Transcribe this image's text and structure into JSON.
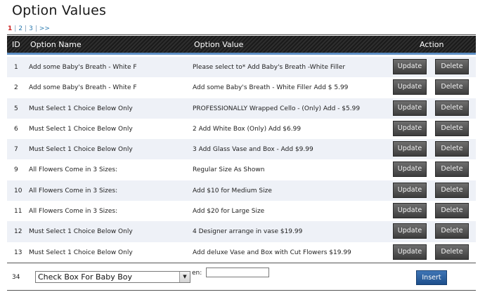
{
  "page": {
    "title": "Option Values"
  },
  "pagination": {
    "pages": [
      "1",
      "2",
      "3"
    ],
    "active": "1",
    "next": ">>"
  },
  "table": {
    "headers": {
      "id": "ID",
      "name": "Option Name",
      "value": "Option Value",
      "action": "Action"
    },
    "rows": [
      {
        "id": "1",
        "name": "Add some Baby's Breath - White F",
        "value": "Please select to* Add Baby's Breath -White Filler"
      },
      {
        "id": "2",
        "name": "Add some Baby's Breath - White F",
        "value": "Add some Baby's Breath - White Filler Add $ 5.99"
      },
      {
        "id": "5",
        "name": "Must Select 1 Choice Below Only",
        "value": "PROFESSIONALLY Wrapped Cello - (Only) Add - $5.99"
      },
      {
        "id": "6",
        "name": "Must Select 1 Choice Below Only",
        "value": "2 Add White Box (Only) Add $6.99"
      },
      {
        "id": "7",
        "name": "Must Select 1 Choice Below Only",
        "value": "3 Add Glass Vase and Box - Add $9.99"
      },
      {
        "id": "9",
        "name": "All Flowers Come in 3 Sizes:",
        "value": "Regular Size As Shown"
      },
      {
        "id": "10",
        "name": "All Flowers Come in 3 Sizes:",
        "value": "Add $10 for Medium Size"
      },
      {
        "id": "11",
        "name": "All Flowers Come in 3 Sizes:",
        "value": "Add $20 for Large Size"
      },
      {
        "id": "12",
        "name": "Must Select 1 Choice Below Only",
        "value": "4 Designer arrange in vase $19.99"
      },
      {
        "id": "13",
        "name": "Must Select 1 Choice Below Only",
        "value": "Add deluxe Vase and Box with Cut Flowers $19.99"
      }
    ],
    "update_label": "Update",
    "delete_label": "Delete"
  },
  "insert": {
    "new_id": "34",
    "selected_option": "Check Box For Baby Boy",
    "lang_label": "en:",
    "lang_value": "",
    "insert_label": "Insert"
  },
  "colors": {
    "header_bg": "#1b1b1b",
    "header_underline": "#5d8ec4",
    "row_alt": "#eef1f7",
    "button_dark": "#3d3d3d",
    "button_insert": "#1d4f8c",
    "active_page": "#cc2222",
    "link": "#2a7ab0"
  }
}
